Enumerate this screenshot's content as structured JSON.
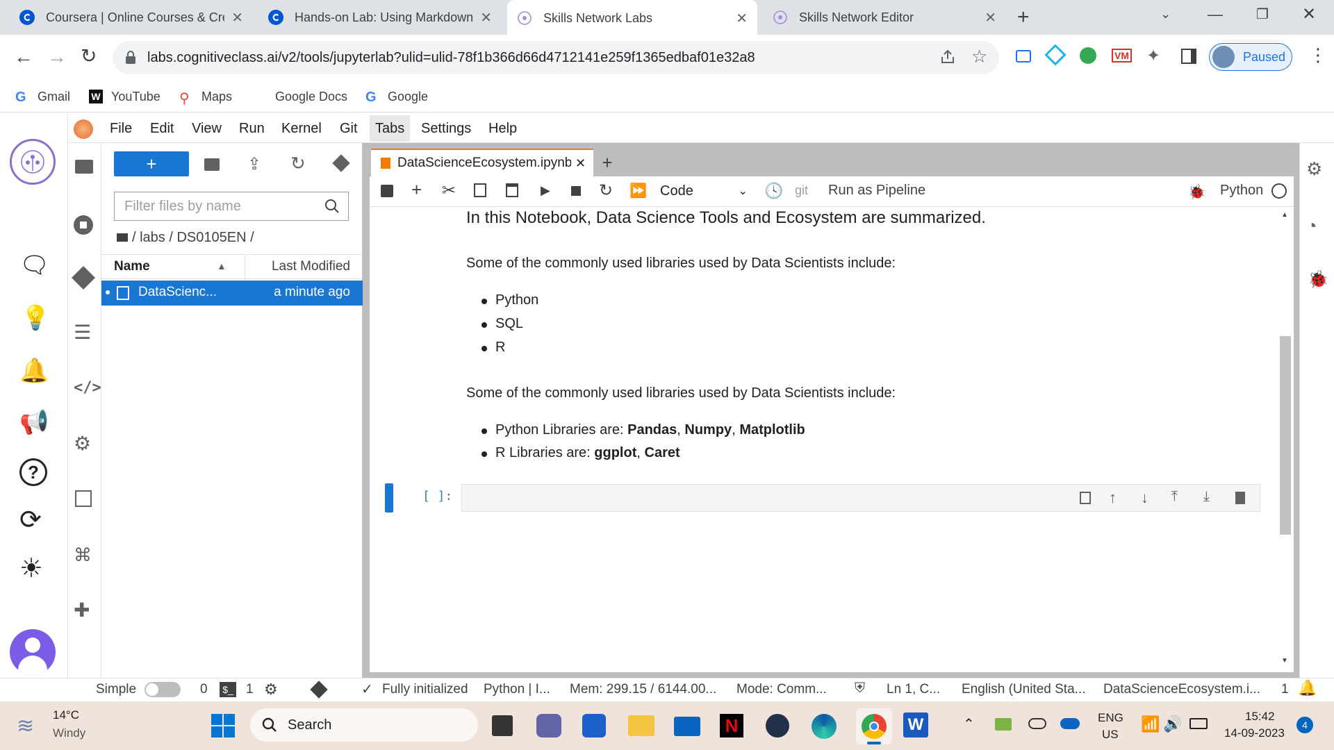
{
  "browser": {
    "tabs": [
      {
        "title": "Coursera | Online Courses & Crec",
        "icon": "coursera-icon",
        "active": false
      },
      {
        "title": "Hands-on Lab: Using Markdown",
        "icon": "coursera-icon",
        "active": false
      },
      {
        "title": "Skills Network Labs",
        "icon": "skills-network-icon",
        "active": true
      },
      {
        "title": "Skills Network Editor",
        "icon": "skills-network-icon",
        "active": false
      }
    ],
    "url": "labs.cognitiveclass.ai/v2/tools/jupyterlab?ulid=ulid-78f1b366d66d4712141e259f1365edbaf01e32a8",
    "profile_label": "Paused",
    "bookmarks": [
      "Gmail",
      "YouTube",
      "Maps",
      "Google Docs",
      "Google"
    ]
  },
  "jupyter": {
    "menu": [
      "File",
      "Edit",
      "View",
      "Run",
      "Kernel",
      "Git",
      "Tabs",
      "Settings",
      "Help"
    ],
    "filter_placeholder": "Filter files by name",
    "breadcrumb": "/ labs / DS0105EN /",
    "columns": {
      "name": "Name",
      "modified": "Last Modified"
    },
    "files": [
      {
        "name": "DataScienc...",
        "modified": "a minute ago"
      }
    ],
    "doc_tab": "DataScienceEcosystem.ipynb",
    "cell_type": "Code",
    "git_label": "git",
    "pipeline_label": "Run as Pipeline",
    "kernel_name": "Python",
    "notebook": {
      "heading": "In this Notebook, Data Science Tools and Ecosystem are summarized.",
      "p1": "Some of the commonly used libraries used by Data Scientists include:",
      "list1": [
        "Python",
        "SQL",
        "R"
      ],
      "p2": "Some of the commonly used libraries used by Data Scientists include:",
      "py_prefix": "Python Libraries are: ",
      "py_libs": [
        "Pandas",
        "Numpy",
        "Matplotlib"
      ],
      "r_prefix": "R Libraries are: ",
      "r_libs": [
        "ggplot",
        "Caret"
      ],
      "prompt": "[ ]:"
    },
    "status": {
      "mode_label": "Simple",
      "terminals": "0",
      "kernels": "1",
      "init": "Fully initialized",
      "kernel": "Python | I...",
      "mem": "Mem: 299.15 / 6144.00...",
      "mode": "Mode: Comm...",
      "cursor": "Ln 1, C...",
      "lang": "English (United Sta...",
      "file": "DataScienceEcosystem.i...",
      "notifications": "1"
    }
  },
  "taskbar": {
    "weather_temp": "14°C",
    "weather_desc": "Windy",
    "search_label": "Search",
    "lang1": "ENG",
    "lang2": "US",
    "time": "15:42",
    "date": "14-09-2023",
    "badge": "4"
  },
  "colors": {
    "accent": "#1976d2",
    "tab_accent": "#f57c00",
    "taskbar": "#efe3dc"
  }
}
